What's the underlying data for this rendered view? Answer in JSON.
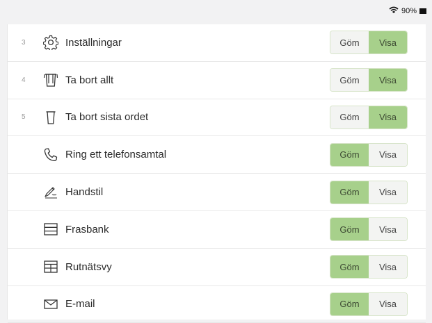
{
  "status": {
    "battery": "90%"
  },
  "toggle": {
    "hide_label": "Göm",
    "show_label": "Visa"
  },
  "rows": [
    {
      "num": "3",
      "icon": "gear-icon",
      "label": "Inställningar",
      "state": "show"
    },
    {
      "num": "4",
      "icon": "trash-all-icon",
      "label": "Ta bort allt",
      "state": "show"
    },
    {
      "num": "5",
      "icon": "trash-icon",
      "label": "Ta bort sista ordet",
      "state": "show"
    },
    {
      "num": "",
      "icon": "phone-icon",
      "label": "Ring ett telefonsamtal",
      "state": "hide"
    },
    {
      "num": "",
      "icon": "handwriting-icon",
      "label": "Handstil",
      "state": "hide"
    },
    {
      "num": "",
      "icon": "phrasebank-icon",
      "label": "Frasbank",
      "state": "hide"
    },
    {
      "num": "",
      "icon": "grid-icon",
      "label": "Rutnätsvy",
      "state": "hide"
    },
    {
      "num": "",
      "icon": "mail-icon",
      "label": "E-mail",
      "state": "hide"
    }
  ],
  "colors": {
    "active": "#a7d08b",
    "inactive": "#f3f4f2"
  }
}
